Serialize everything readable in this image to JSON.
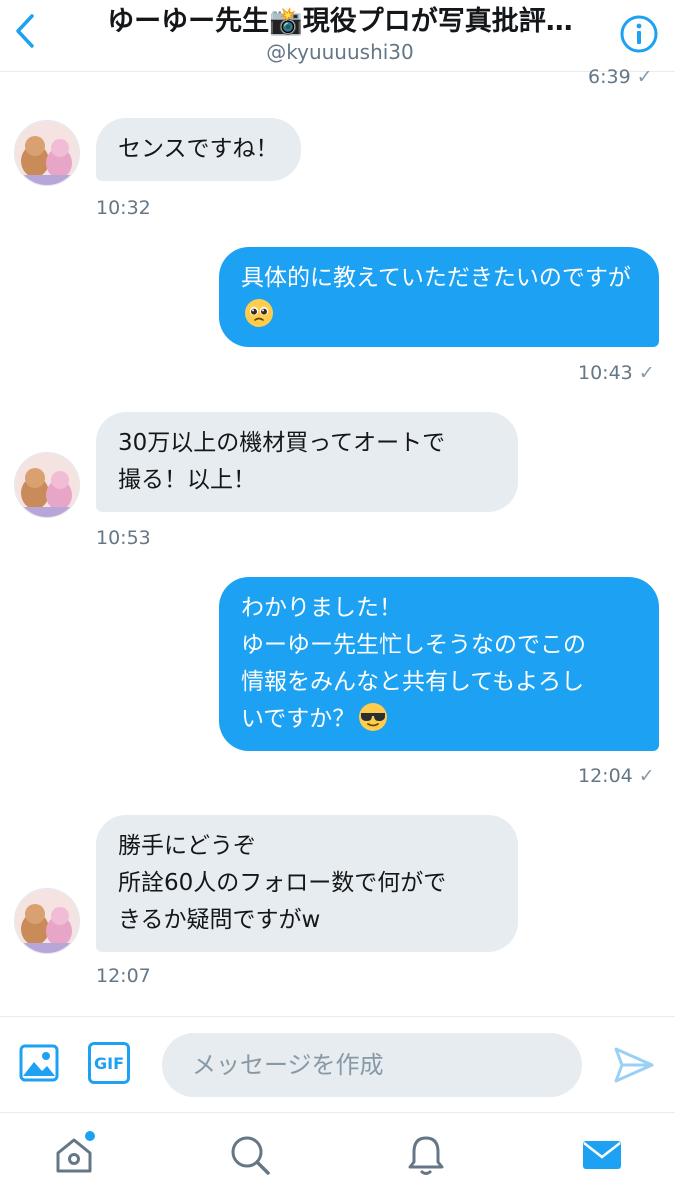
{
  "header": {
    "title": "ゆーゆー先生📸現役プロが写真批評…",
    "handle": "@kyuuuushi30"
  },
  "messages": [
    {
      "direction": "out",
      "time": "6:39",
      "status": "✓"
    },
    {
      "direction": "in",
      "text": "センスですね！",
      "time": "10:32"
    },
    {
      "direction": "out",
      "text": "具体的に教えていただきたいのですが",
      "emoji": "pleading-face",
      "time": "10:43",
      "status": "✓"
    },
    {
      "direction": "in",
      "text": "30万以上の機材買ってオートで\n撮る！以上！",
      "time": "10:53"
    },
    {
      "direction": "out",
      "text": "わかりました！\nゆーゆー先生忙しそうなのでこの\n情報をみんなと共有してもよろし\nいですか？",
      "emoji": "sunglasses-face",
      "time": "12:04",
      "status": "✓"
    },
    {
      "direction": "in",
      "text": "勝手にどうぞ\n所詮60人のフォロー数で何がで\nきるか疑問ですがw",
      "time": "12:07"
    }
  ],
  "composer": {
    "gif_label": "GIF",
    "placeholder": "メッセージを作成"
  },
  "tabs": [
    "home",
    "search",
    "notifications",
    "messages"
  ],
  "colors": {
    "accent": "#1da1f2",
    "bubble_in": "#e6ecf0",
    "muted": "#657786"
  }
}
